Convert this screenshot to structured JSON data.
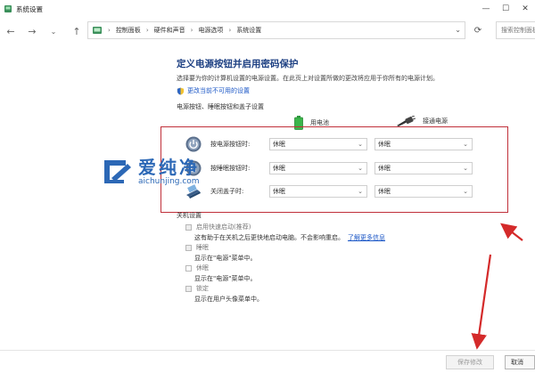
{
  "window": {
    "title": "系统设置",
    "controls": {
      "minimize": "—",
      "maximize": "☐",
      "close": "✕"
    }
  },
  "nav": {
    "back": "←",
    "forward": "→",
    "recent": "⌄",
    "up": "↑",
    "breadcrumbs": [
      "控制面板",
      "硬件和声音",
      "电源选项",
      "系统设置"
    ],
    "crumb_sep": "›",
    "dropdown": "⌄",
    "refresh": "⟳",
    "search_placeholder": "搜索控制面板"
  },
  "page": {
    "title": "定义电源按钮并启用密码保护",
    "description": "选择要为你的计算机设置的电源设置。在此页上对设置所做的更改将应用于你所有的电源计划。",
    "change_link": "更改当前不可用的设置",
    "section_title": "电源按钮、睡眠按钮和盖子设置",
    "col_battery": "用电池",
    "col_plugged": "接通电源"
  },
  "settings_rows": [
    {
      "label": "按电源按钮时:",
      "battery": "休眠",
      "plugged": "休眠",
      "icon": "power-button-icon"
    },
    {
      "label": "按睡眠按钮时:",
      "battery": "休眠",
      "plugged": "休眠",
      "icon": "sleep-button-icon"
    },
    {
      "label": "关闭盖子时:",
      "battery": "休眠",
      "plugged": "休眠",
      "icon": "laptop-lid-icon"
    }
  ],
  "shutdown": {
    "title": "关机设置",
    "options": [
      {
        "title": "启用快速启动(推荐)",
        "desc": "这有助于在关机之后更快地启动电脑。不会影响重启。",
        "link": "了解更多信息"
      },
      {
        "title": "睡眠",
        "desc": "显示在\"电源\"菜单中。",
        "link": ""
      },
      {
        "title": "休眠",
        "desc": "显示在\"电源\"菜单中。",
        "link": ""
      },
      {
        "title": "锁定",
        "desc": "显示在用户头像菜单中。",
        "link": ""
      }
    ]
  },
  "footer": {
    "save_label": "保存修改",
    "cancel_label": "取消"
  },
  "watermark": {
    "cn": "爱纯净",
    "en": "aichunjing.com"
  },
  "colors": {
    "accent": "#1c3f82",
    "link": "#1a56c6",
    "highlight": "#c0303a",
    "battery": "#3bb54a"
  }
}
